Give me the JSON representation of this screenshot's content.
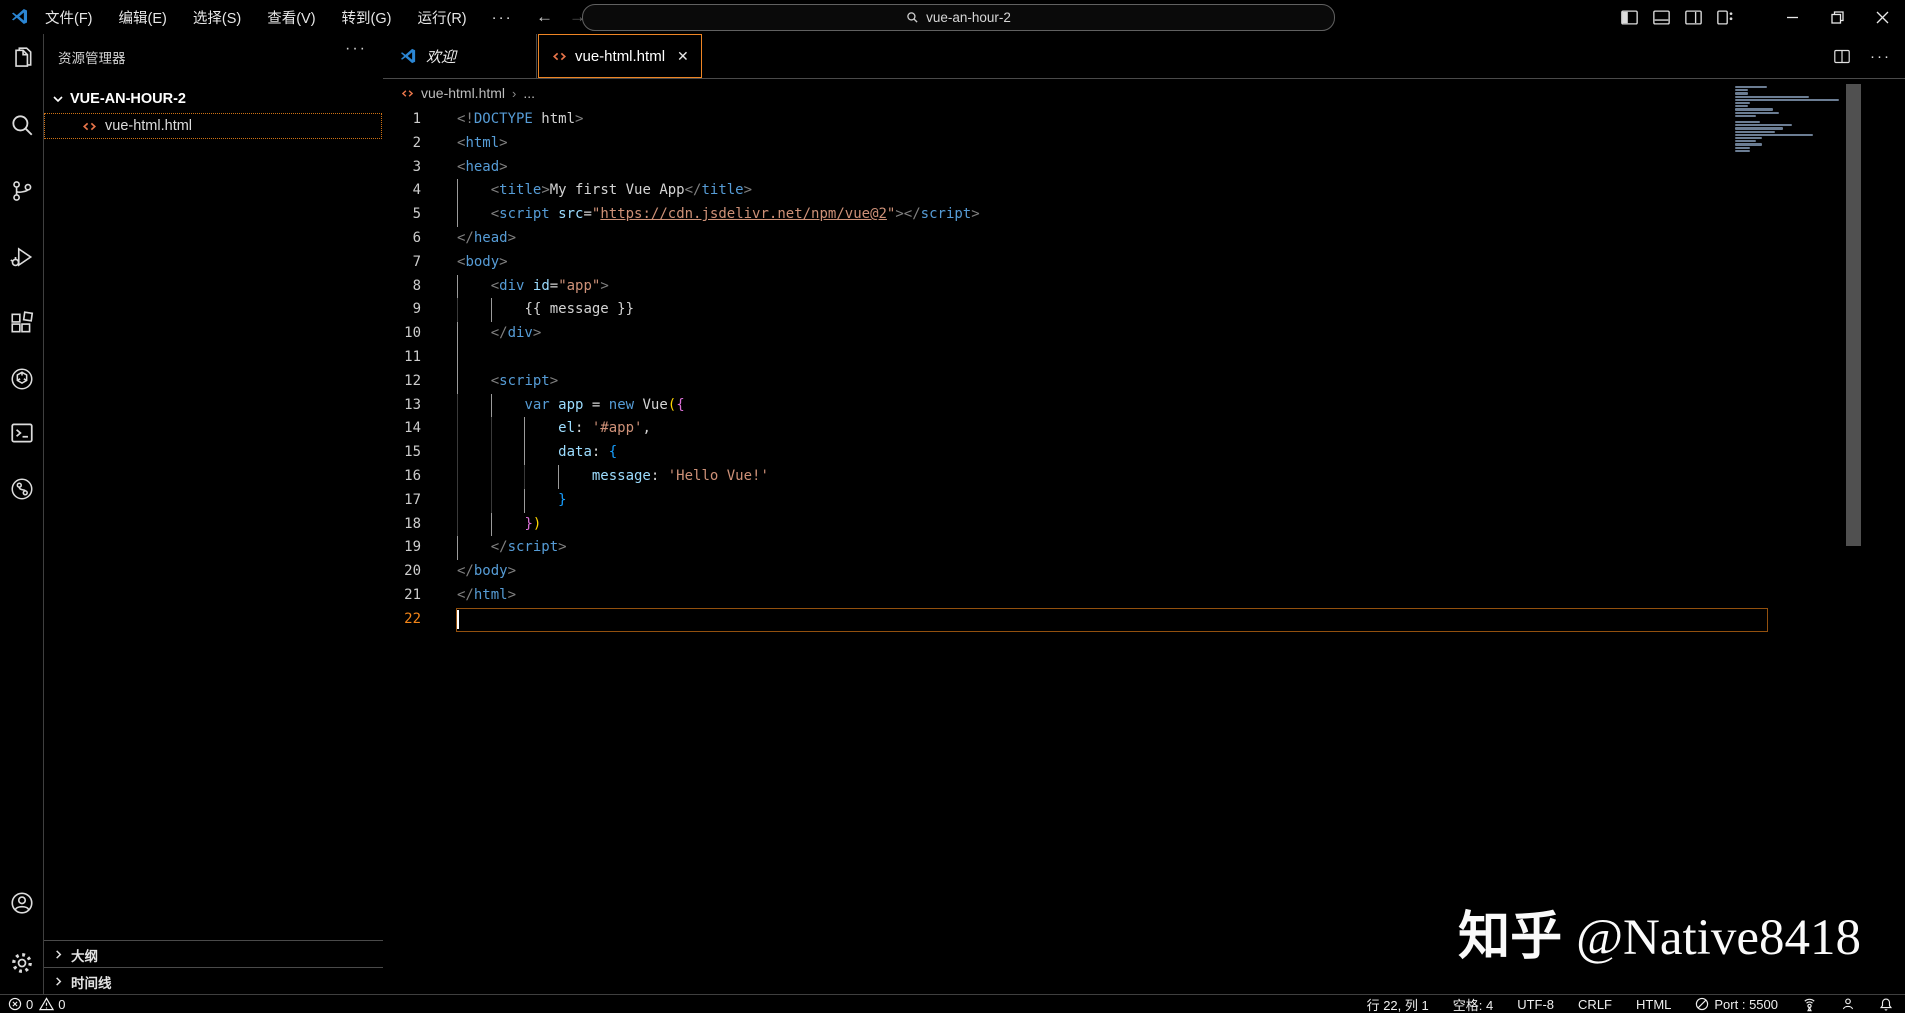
{
  "title_bar": {
    "menus": [
      "文件(F)",
      "编辑(E)",
      "选择(S)",
      "查看(V)",
      "转到(G)",
      "运行(R)"
    ],
    "more_label": "···",
    "search_value": "vue-an-hour-2"
  },
  "activity_bar": {
    "icons": [
      "explorer-icon",
      "search-icon",
      "source-control-icon",
      "run-debug-icon",
      "extensions-icon",
      "chatgpt-icon",
      "terminal-icon",
      "git-graph-icon",
      "account-icon",
      "settings-icon"
    ]
  },
  "sidebar": {
    "title": "资源管理器",
    "more_label": "···",
    "project": "VUE-AN-HOUR-2",
    "file": "vue-html.html",
    "sections": {
      "outline": "大纲",
      "timeline": "时间线"
    }
  },
  "tabs": {
    "welcome": "欢迎",
    "file": "vue-html.html",
    "close": "✕"
  },
  "breadcrumb": {
    "file": "vue-html.html",
    "more": "..."
  },
  "editor": {
    "lines": [
      {
        "n": 1,
        "t": [
          [
            "p",
            "<!"
          ],
          [
            "t",
            "DOCTYPE"
          ],
          [
            "w",
            " html"
          ],
          [
            "p",
            ">"
          ]
        ]
      },
      {
        "n": 2,
        "t": [
          [
            "p",
            "<"
          ],
          [
            "t",
            "html"
          ],
          [
            "p",
            ">"
          ]
        ]
      },
      {
        "n": 3,
        "t": [
          [
            "p",
            "<"
          ],
          [
            "t",
            "head"
          ],
          [
            "p",
            ">"
          ]
        ]
      },
      {
        "n": 4,
        "g": 0,
        "t": [
          [
            "w",
            "    "
          ],
          [
            "p",
            "<"
          ],
          [
            "t",
            "title"
          ],
          [
            "p",
            ">"
          ],
          [
            "w",
            "My first Vue App"
          ],
          [
            "p",
            "</"
          ],
          [
            "t",
            "title"
          ],
          [
            "p",
            ">"
          ]
        ]
      },
      {
        "n": 5,
        "g": 0,
        "t": [
          [
            "w",
            "    "
          ],
          [
            "p",
            "<"
          ],
          [
            "t",
            "script"
          ],
          [
            "w",
            " "
          ],
          [
            "a",
            "src"
          ],
          [
            "w",
            "="
          ],
          [
            "s",
            "\""
          ],
          [
            "su",
            "https://cdn.jsdelivr.net/npm/vue@2"
          ],
          [
            "s",
            "\""
          ],
          [
            "p",
            ">"
          ],
          [
            "p",
            "</"
          ],
          [
            "t",
            "script"
          ],
          [
            "p",
            ">"
          ]
        ]
      },
      {
        "n": 6,
        "t": [
          [
            "p",
            "</"
          ],
          [
            "t",
            "head"
          ],
          [
            "p",
            ">"
          ]
        ]
      },
      {
        "n": 7,
        "t": [
          [
            "p",
            "<"
          ],
          [
            "t",
            "body"
          ],
          [
            "p",
            ">"
          ]
        ]
      },
      {
        "n": 8,
        "g": 0,
        "t": [
          [
            "w",
            "    "
          ],
          [
            "p",
            "<"
          ],
          [
            "t",
            "div"
          ],
          [
            "w",
            " "
          ],
          [
            "a",
            "id"
          ],
          [
            "w",
            "="
          ],
          [
            "s",
            "\"app\""
          ],
          [
            "p",
            ">"
          ]
        ]
      },
      {
        "n": 9,
        "g": 4,
        "d": [
          0
        ],
        "t": [
          [
            "w",
            "        "
          ],
          [
            "w",
            "{{ message }}"
          ]
        ]
      },
      {
        "n": 10,
        "g": 0,
        "t": [
          [
            "w",
            "    "
          ],
          [
            "p",
            "</"
          ],
          [
            "t",
            "div"
          ],
          [
            "p",
            ">"
          ]
        ]
      },
      {
        "n": 11,
        "g": 0,
        "t": []
      },
      {
        "n": 12,
        "g": 0,
        "t": [
          [
            "w",
            "    "
          ],
          [
            "p",
            "<"
          ],
          [
            "t",
            "script"
          ],
          [
            "p",
            ">"
          ]
        ]
      },
      {
        "n": 13,
        "g": 4,
        "d": [
          0
        ],
        "t": [
          [
            "w",
            "        "
          ],
          [
            "k",
            "var"
          ],
          [
            "w",
            " "
          ],
          [
            "a",
            "app"
          ],
          [
            "w",
            " = "
          ],
          [
            "k",
            "new"
          ],
          [
            "w",
            " "
          ],
          [
            "w",
            "Vue"
          ],
          [
            "b1",
            "("
          ],
          [
            "b2",
            "{"
          ]
        ]
      },
      {
        "n": 14,
        "g": 8,
        "d": [
          0,
          4
        ],
        "t": [
          [
            "w",
            "            "
          ],
          [
            "a",
            "el"
          ],
          [
            "w",
            ": "
          ],
          [
            "s",
            "'#app'"
          ],
          [
            "w",
            ","
          ]
        ]
      },
      {
        "n": 15,
        "g": 8,
        "d": [
          0,
          4
        ],
        "t": [
          [
            "w",
            "            "
          ],
          [
            "a",
            "data"
          ],
          [
            "w",
            ": "
          ],
          [
            "b3",
            "{"
          ]
        ]
      },
      {
        "n": 16,
        "g": 12,
        "d": [
          0,
          4,
          8
        ],
        "t": [
          [
            "w",
            "                "
          ],
          [
            "a",
            "message"
          ],
          [
            "w",
            ": "
          ],
          [
            "s",
            "'Hello Vue!'"
          ]
        ]
      },
      {
        "n": 17,
        "g": 8,
        "d": [
          0,
          4
        ],
        "t": [
          [
            "w",
            "            "
          ],
          [
            "b3",
            "}"
          ]
        ]
      },
      {
        "n": 18,
        "g": 4,
        "d": [
          0
        ],
        "t": [
          [
            "w",
            "        "
          ],
          [
            "b2",
            "}"
          ],
          [
            "b1",
            ")"
          ]
        ]
      },
      {
        "n": 19,
        "g": 0,
        "t": [
          [
            "w",
            "    "
          ],
          [
            "p",
            "</"
          ],
          [
            "t",
            "script"
          ],
          [
            "p",
            ">"
          ]
        ]
      },
      {
        "n": 20,
        "t": [
          [
            "p",
            "</"
          ],
          [
            "t",
            "body"
          ],
          [
            "p",
            ">"
          ]
        ]
      },
      {
        "n": 21,
        "t": [
          [
            "p",
            "</"
          ],
          [
            "t",
            "html"
          ],
          [
            "p",
            ">"
          ]
        ]
      },
      {
        "n": 22,
        "cur": true,
        "t": []
      }
    ]
  },
  "status_bar": {
    "errors": "0",
    "warnings": "0",
    "cursor": "行 22, 列 1",
    "indent": "空格: 4",
    "encoding": "UTF-8",
    "eol": "CRLF",
    "language": "HTML",
    "port": "Port : 5500"
  },
  "watermark": {
    "brand": "知乎",
    "handle": "@Native8418"
  },
  "colors": {
    "background": "#000000",
    "accent_focus": "#f38518",
    "tag": "#569cd6",
    "attribute": "#9cdcfe",
    "string": "#ce9178",
    "punctuation": "#808080",
    "bracket1": "#ffd700",
    "bracket2": "#da70d6",
    "bracket3": "#179fff",
    "html_icon": "#e8754a",
    "logo_blue": "#2b86d4"
  }
}
